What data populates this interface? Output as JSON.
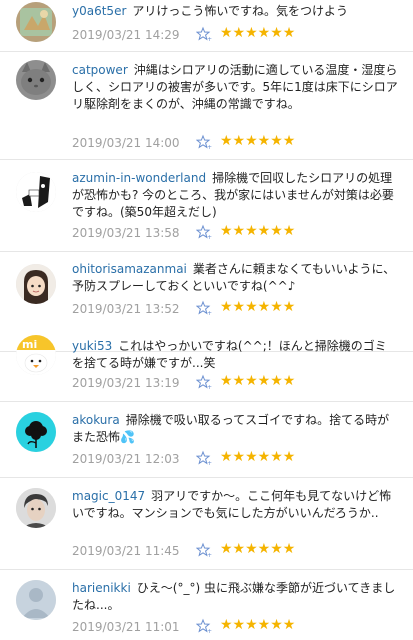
{
  "comments": [
    {
      "username": "y0a6t5er",
      "text": "アリけっこう怖いですね。気をつけよう",
      "date": "2019/03/21 14:29",
      "rating_text": "★★★★★★",
      "rating_count": 6
    },
    {
      "username": "catpower",
      "text": "沖縄はシロアリの活動に適している温度・湿度らしく、シロアリの被害が多いです。5年に1度は床下にシロアリ駆除剤をまくのが、沖縄の常識ですね。",
      "date": "2019/03/21 14:00",
      "rating_text": "★★★★★★",
      "rating_count": 6
    },
    {
      "username": "azumin-in-wonderland",
      "text": "掃除機で回収したシロアリの処理が恐怖かも? 今のところ、我が家にはいませんが対策は必要ですね。(築50年超えだし)",
      "date": "2019/03/21 13:58",
      "rating_text": "★★★★★★",
      "rating_count": 6
    },
    {
      "username": "ohitorisamazanmai",
      "text": "業者さんに頼まなくてもいいように、予防スプレーしておくといいですね(^^♪",
      "date": "2019/03/21 13:52",
      "rating_text": "★★★★★★",
      "rating_count": 6
    },
    {
      "username": "yuki53",
      "text": "これはやっかいですね(^^;！ほんと掃除機のゴミを捨てる時が嫌ですが...笑",
      "date": "2019/03/21 13:19",
      "rating_text": "★★★★★★",
      "rating_count": 6
    },
    {
      "username": "akokura",
      "text": "掃除機で吸い取るってスゴイですね。捨てる時がまた恐怖💦",
      "date": "2019/03/21 12:03",
      "rating_text": "★★★★★★",
      "rating_count": 6
    },
    {
      "username": "magic_0147",
      "text": "羽アリですか〜。ここ何年も見てないけど怖いですね。マンションでも気にした方がいいんだろうか..",
      "date": "2019/03/21 11:45",
      "rating_text": "★★★★★★",
      "rating_count": 6
    },
    {
      "username": "harienikki",
      "text": "ひえ〜(°_°) 虫に飛ぶ嫌な季節が近づいてきましたね...。",
      "date": "2019/03/21 11:01",
      "rating_text": "★★★★★★",
      "rating_count": 6
    }
  ],
  "colors": {
    "username": "#2a6fa8",
    "star": "#f5b400",
    "meta": "#a0a0a0",
    "fav_icon": "#6a8fd0"
  }
}
